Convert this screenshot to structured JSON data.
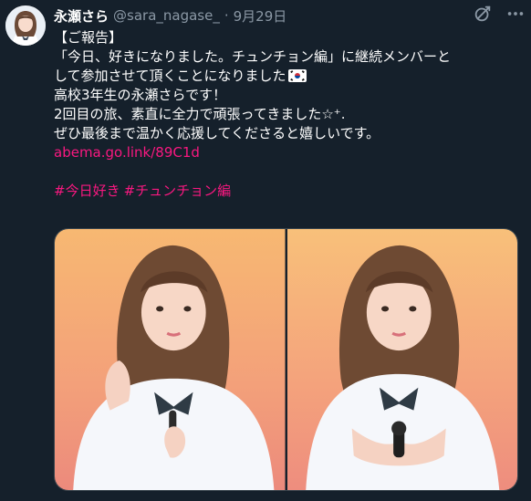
{
  "author": {
    "display_name": "永瀬さら",
    "handle": "@sara_nagase_",
    "separator": "·",
    "date": "9月29日"
  },
  "icons": {
    "avatar": "profile-avatar",
    "grok": "grok-icon",
    "more": "more-options-icon",
    "flag": "korea-flag-emoji",
    "sparkle": "sparkle-emoji"
  },
  "tweet": {
    "line1": "【ご報告】",
    "line2": "「今日、好きになりました。チュンチョン編」に継続メンバーと",
    "line3": "して参加させて頂くことになりました",
    "line4": "高校3年生の永瀬さらです！",
    "line5_text": "2回目の旅、素直に全力で頑張ってきました",
    "line5_emoji": "☆⁺.",
    "line6": "ぜひ最後まで温かく応援してくださると嬉しいです。",
    "link": "abema.go.link/89C1d",
    "hashtags": [
      "#今日好き",
      "#チュンチョン編"
    ]
  },
  "media": {
    "photos": [
      "photo-1",
      "photo-2"
    ]
  },
  "colors": {
    "background": "#15202b",
    "text": "#ffffff",
    "muted": "#8b98a5",
    "accent": "#f91880"
  }
}
